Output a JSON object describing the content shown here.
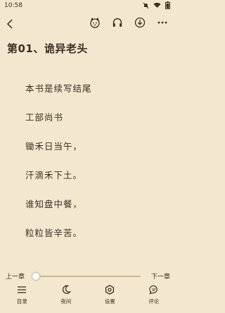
{
  "status": {
    "time": "10:58"
  },
  "chapter": {
    "title": "第01、诡异老头"
  },
  "content": {
    "lines": [
      "本书是续写结尾",
      "工部尚书",
      "锄禾日当午，",
      "汗滴禾下土。",
      "谁知盘中餐，",
      "粒粒皆辛苦。"
    ]
  },
  "progress": {
    "prev_label": "上一章",
    "next_label": "下一章",
    "value": 0.0
  },
  "nav": {
    "items": [
      {
        "label": "目录",
        "icon": "menu-list-icon"
      },
      {
        "label": "夜间",
        "icon": "moon-icon"
      },
      {
        "label": "设置",
        "icon": "gear-icon"
      },
      {
        "label": "评论",
        "icon": "comment-icon"
      }
    ]
  },
  "colors": {
    "background": "#f3e7cf",
    "text": "#3a2f24"
  }
}
